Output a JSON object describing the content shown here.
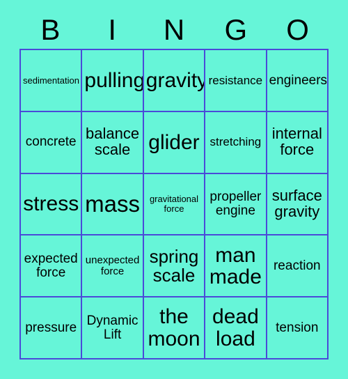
{
  "card": {
    "title": "BINGO",
    "background_color": "#66f5d8",
    "grid_line_color": "#4a4ad8",
    "text_color": "#000000"
  },
  "header": {
    "letters": [
      {
        "label": "B"
      },
      {
        "label": "I"
      },
      {
        "label": "N"
      },
      {
        "label": "G"
      },
      {
        "label": "O"
      }
    ]
  },
  "grid": {
    "rows": 5,
    "columns": 5,
    "cells": [
      {
        "text": "sedimentation",
        "size": "xs",
        "row": 1,
        "col": 1
      },
      {
        "text": "pulling",
        "size": "xxl",
        "row": 1,
        "col": 2
      },
      {
        "text": "gravity",
        "size": "xxl",
        "row": 1,
        "col": 3
      },
      {
        "text": "resistance",
        "size": "m",
        "row": 1,
        "col": 4
      },
      {
        "text": "engineers",
        "size": "ml",
        "row": 1,
        "col": 5
      },
      {
        "text": "concrete",
        "size": "ml",
        "row": 2,
        "col": 1
      },
      {
        "text": "balance scale",
        "size": "l",
        "row": 2,
        "col": 2
      },
      {
        "text": "glider",
        "size": "xxl",
        "row": 2,
        "col": 3
      },
      {
        "text": "stretching",
        "size": "m",
        "row": 2,
        "col": 4
      },
      {
        "text": "internal force",
        "size": "l",
        "row": 2,
        "col": 5
      },
      {
        "text": "stress",
        "size": "xxl",
        "row": 3,
        "col": 1
      },
      {
        "text": "mass",
        "size": "xxxl",
        "row": 3,
        "col": 2
      },
      {
        "text": "gravitational force",
        "size": "xs",
        "row": 3,
        "col": 3
      },
      {
        "text": "propeller engine",
        "size": "ml",
        "row": 3,
        "col": 4
      },
      {
        "text": "surface gravity",
        "size": "l",
        "row": 3,
        "col": 5
      },
      {
        "text": "expected force",
        "size": "ml",
        "row": 4,
        "col": 1
      },
      {
        "text": "unexpected force",
        "size": "s",
        "row": 4,
        "col": 2
      },
      {
        "text": "spring scale",
        "size": "xl",
        "row": 4,
        "col": 3
      },
      {
        "text": "man made",
        "size": "xxl",
        "row": 4,
        "col": 4
      },
      {
        "text": "reaction",
        "size": "ml",
        "row": 4,
        "col": 5
      },
      {
        "text": "pressure",
        "size": "ml",
        "row": 5,
        "col": 1
      },
      {
        "text": "Dynamic Lift",
        "size": "ml",
        "row": 5,
        "col": 2
      },
      {
        "text": "the moon",
        "size": "xxl",
        "row": 5,
        "col": 3
      },
      {
        "text": "dead load",
        "size": "xxl",
        "row": 5,
        "col": 4
      },
      {
        "text": "tension",
        "size": "ml",
        "row": 5,
        "col": 5
      }
    ]
  }
}
